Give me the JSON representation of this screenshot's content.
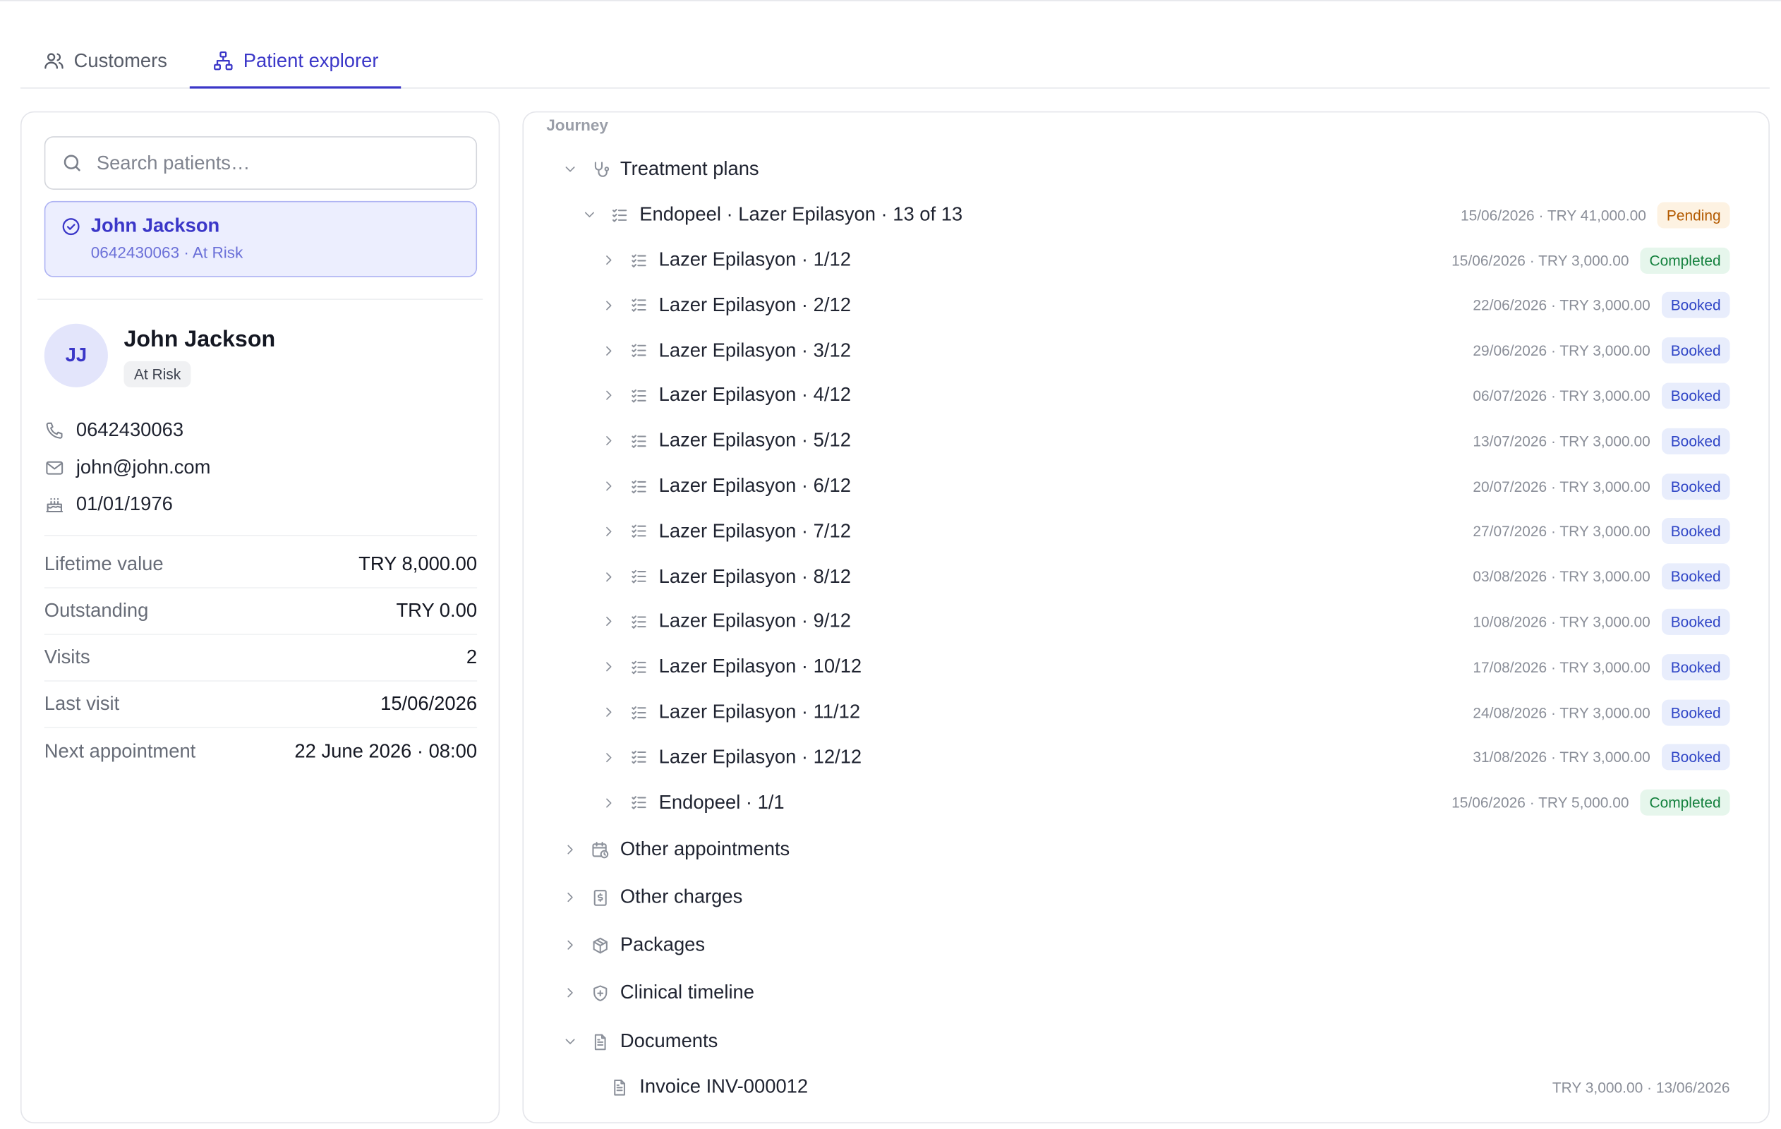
{
  "tabs": [
    {
      "label": "Customers",
      "icon": "users-icon",
      "active": false
    },
    {
      "label": "Patient explorer",
      "icon": "hierarchy-icon",
      "active": true
    }
  ],
  "search": {
    "placeholder": "Search patients…"
  },
  "selected_patient": {
    "name": "John Jackson",
    "subtitle": "0642430063 · At Risk"
  },
  "profile": {
    "initials": "JJ",
    "name": "John Jackson",
    "status": "At Risk",
    "phone": "0642430063",
    "email": "john@john.com",
    "birthday": "01/01/1976"
  },
  "stats": [
    {
      "label": "Lifetime value",
      "value": "TRY 8,000.00"
    },
    {
      "label": "Outstanding",
      "value": "TRY 0.00"
    },
    {
      "label": "Visits",
      "value": "2"
    },
    {
      "label": "Last visit",
      "value": "15/06/2026"
    },
    {
      "label": "Next appointment",
      "value": "22 June 2026 · 08:00"
    }
  ],
  "journey": {
    "label": "Journey",
    "treatment_plans": {
      "label": "Treatment plans",
      "plan": {
        "label": "Endopeel · Lazer Epilasyon · 13 of 13",
        "meta": "15/06/2026 · TRY 41,000.00",
        "status": "Pending"
      },
      "items": [
        {
          "label": "Lazer Epilasyon · 1/12",
          "meta": "15/06/2026 · TRY 3,000.00",
          "status": "Completed"
        },
        {
          "label": "Lazer Epilasyon · 2/12",
          "meta": "22/06/2026 · TRY 3,000.00",
          "status": "Booked"
        },
        {
          "label": "Lazer Epilasyon · 3/12",
          "meta": "29/06/2026 · TRY 3,000.00",
          "status": "Booked"
        },
        {
          "label": "Lazer Epilasyon · 4/12",
          "meta": "06/07/2026 · TRY 3,000.00",
          "status": "Booked"
        },
        {
          "label": "Lazer Epilasyon · 5/12",
          "meta": "13/07/2026 · TRY 3,000.00",
          "status": "Booked"
        },
        {
          "label": "Lazer Epilasyon · 6/12",
          "meta": "20/07/2026 · TRY 3,000.00",
          "status": "Booked"
        },
        {
          "label": "Lazer Epilasyon · 7/12",
          "meta": "27/07/2026 · TRY 3,000.00",
          "status": "Booked"
        },
        {
          "label": "Lazer Epilasyon · 8/12",
          "meta": "03/08/2026 · TRY 3,000.00",
          "status": "Booked"
        },
        {
          "label": "Lazer Epilasyon · 9/12",
          "meta": "10/08/2026 · TRY 3,000.00",
          "status": "Booked"
        },
        {
          "label": "Lazer Epilasyon · 10/12",
          "meta": "17/08/2026 · TRY 3,000.00",
          "status": "Booked"
        },
        {
          "label": "Lazer Epilasyon · 11/12",
          "meta": "24/08/2026 · TRY 3,000.00",
          "status": "Booked"
        },
        {
          "label": "Lazer Epilasyon · 12/12",
          "meta": "31/08/2026 · TRY 3,000.00",
          "status": "Booked"
        },
        {
          "label": "Endopeel · 1/1",
          "meta": "15/06/2026 · TRY 5,000.00",
          "status": "Completed"
        }
      ]
    },
    "sections": [
      {
        "label": "Other appointments",
        "icon": "calendar-clock-icon"
      },
      {
        "label": "Other charges",
        "icon": "receipt-icon"
      },
      {
        "label": "Packages",
        "icon": "package-icon"
      },
      {
        "label": "Clinical timeline",
        "icon": "shield-plus-icon"
      }
    ],
    "documents": {
      "label": "Documents",
      "items": [
        {
          "label": "Invoice INV-000012",
          "meta": "TRY 3,000.00 · 13/06/2026"
        }
      ]
    }
  }
}
